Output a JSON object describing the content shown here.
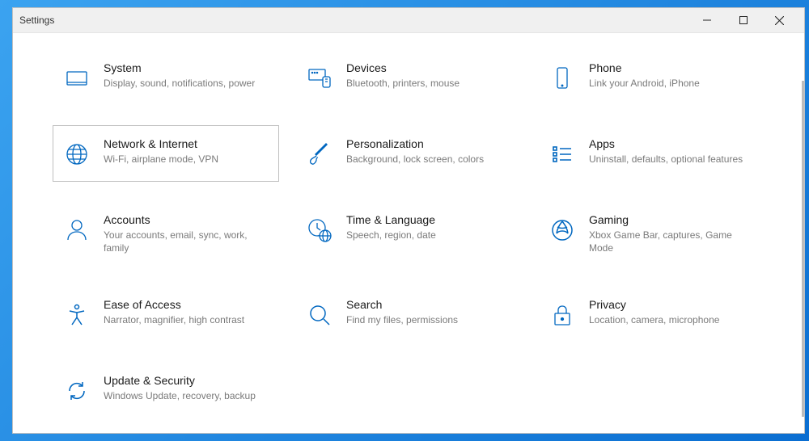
{
  "window": {
    "title": "Settings"
  },
  "categories": [
    {
      "key": "system",
      "title": "System",
      "desc": "Display, sound, notifications, power",
      "selected": false
    },
    {
      "key": "devices",
      "title": "Devices",
      "desc": "Bluetooth, printers, mouse",
      "selected": false
    },
    {
      "key": "phone",
      "title": "Phone",
      "desc": "Link your Android, iPhone",
      "selected": false
    },
    {
      "key": "network",
      "title": "Network & Internet",
      "desc": "Wi-Fi, airplane mode, VPN",
      "selected": true
    },
    {
      "key": "personalization",
      "title": "Personalization",
      "desc": "Background, lock screen, colors",
      "selected": false
    },
    {
      "key": "apps",
      "title": "Apps",
      "desc": "Uninstall, defaults, optional features",
      "selected": false
    },
    {
      "key": "accounts",
      "title": "Accounts",
      "desc": "Your accounts, email, sync, work, family",
      "selected": false
    },
    {
      "key": "time",
      "title": "Time & Language",
      "desc": "Speech, region, date",
      "selected": false
    },
    {
      "key": "gaming",
      "title": "Gaming",
      "desc": "Xbox Game Bar, captures, Game Mode",
      "selected": false
    },
    {
      "key": "ease",
      "title": "Ease of Access",
      "desc": "Narrator, magnifier, high contrast",
      "selected": false
    },
    {
      "key": "search",
      "title": "Search",
      "desc": "Find my files, permissions",
      "selected": false
    },
    {
      "key": "privacy",
      "title": "Privacy",
      "desc": "Location, camera, microphone",
      "selected": false
    },
    {
      "key": "update",
      "title": "Update & Security",
      "desc": "Windows Update, recovery, backup",
      "selected": false
    }
  ]
}
